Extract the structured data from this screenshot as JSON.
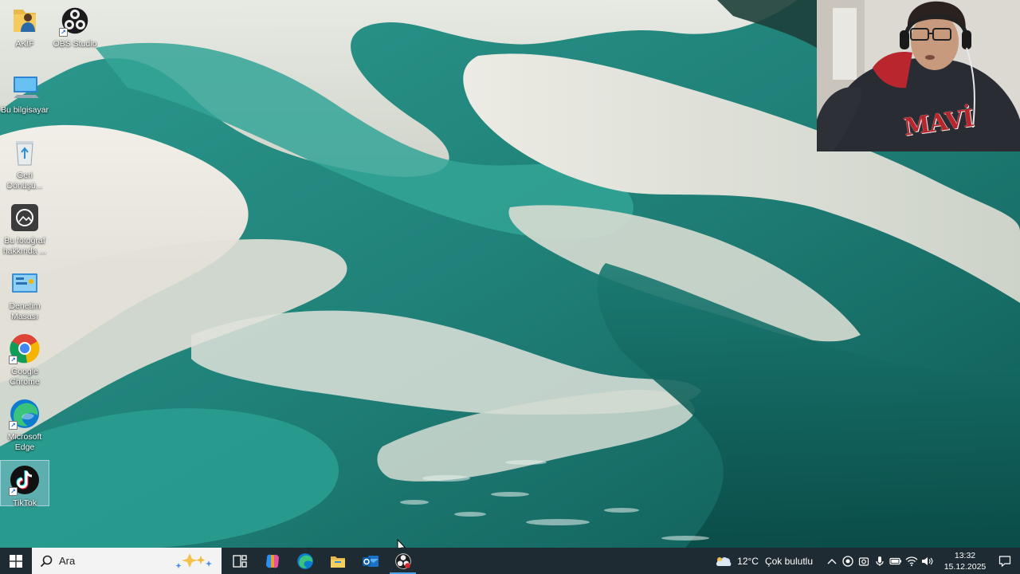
{
  "desktop": {
    "icons": [
      {
        "label": "AKİF",
        "icon": "user-folder-icon"
      },
      {
        "label": "OBS Studio",
        "icon": "obs-icon"
      },
      {
        "label": "Bu bilgisayar",
        "icon": "computer-icon"
      },
      {
        "label": "Geri Dönüşü...",
        "icon": "recycle-bin-icon"
      },
      {
        "label": "Bu fotoğraf hakkında ...",
        "icon": "photo-info-icon"
      },
      {
        "label": "Denetim Masası",
        "icon": "control-panel-icon"
      },
      {
        "label": "Google Chrome",
        "icon": "chrome-icon"
      },
      {
        "label": "Microsoft Edge",
        "icon": "edge-icon"
      },
      {
        "label": "TikTok",
        "icon": "tiktok-icon"
      }
    ]
  },
  "webcam": {
    "shirt_text": "MAVİ"
  },
  "taskbar": {
    "search_placeholder": "Ara",
    "pinned_apps": [
      "task-view-icon",
      "copilot-icon",
      "edge-icon",
      "file-explorer-icon",
      "outlook-icon",
      "obs-icon"
    ],
    "active_app": "obs-icon",
    "accent_color": "#4aa3e8"
  },
  "tray": {
    "weather_temp": "12°C",
    "weather_condition": "Çok bulutlu",
    "time": "13:32",
    "date": "15.12.2025"
  }
}
